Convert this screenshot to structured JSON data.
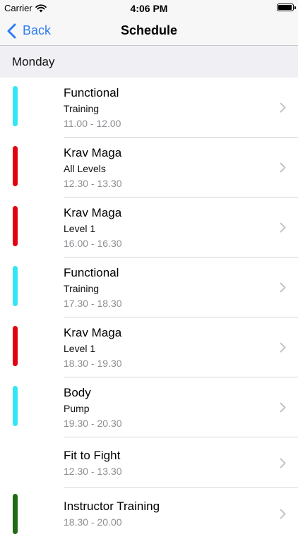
{
  "status_bar": {
    "carrier": "Carrier",
    "time": "4:06 PM",
    "wifi_icon": "wifi-icon",
    "battery_icon": "battery-icon"
  },
  "nav": {
    "back_label": "Back",
    "title": "Schedule",
    "accent": "#2f7cf6"
  },
  "section": {
    "title": "Monday"
  },
  "classes": [
    {
      "title": "Functional",
      "subtitle": "Training",
      "time": "11.00 - 12.00",
      "color": "#33e6f5"
    },
    {
      "title": "Krav Maga",
      "subtitle": "All Levels",
      "time": "12.30 - 13.30",
      "color": "#e3000f"
    },
    {
      "title": "Krav Maga",
      "subtitle": "Level 1",
      "time": "16.00 - 16.30",
      "color": "#e3000f"
    },
    {
      "title": "Functional",
      "subtitle": "Training",
      "time": "17.30 - 18.30",
      "color": "#33e6f5"
    },
    {
      "title": "Krav Maga",
      "subtitle": "Level 1",
      "time": "18.30 - 19.30",
      "color": "#e3000f"
    },
    {
      "title": "Body",
      "subtitle": "Pump",
      "time": "19.30 - 20.30",
      "color": "#33e6f5"
    },
    {
      "title": "Fit to Fight",
      "subtitle": "",
      "time": "12.30 - 13.30",
      "color": ""
    },
    {
      "title": "Instructor Training",
      "subtitle": "",
      "time": "18.30 - 20.00",
      "color": "#1e6b12"
    }
  ]
}
